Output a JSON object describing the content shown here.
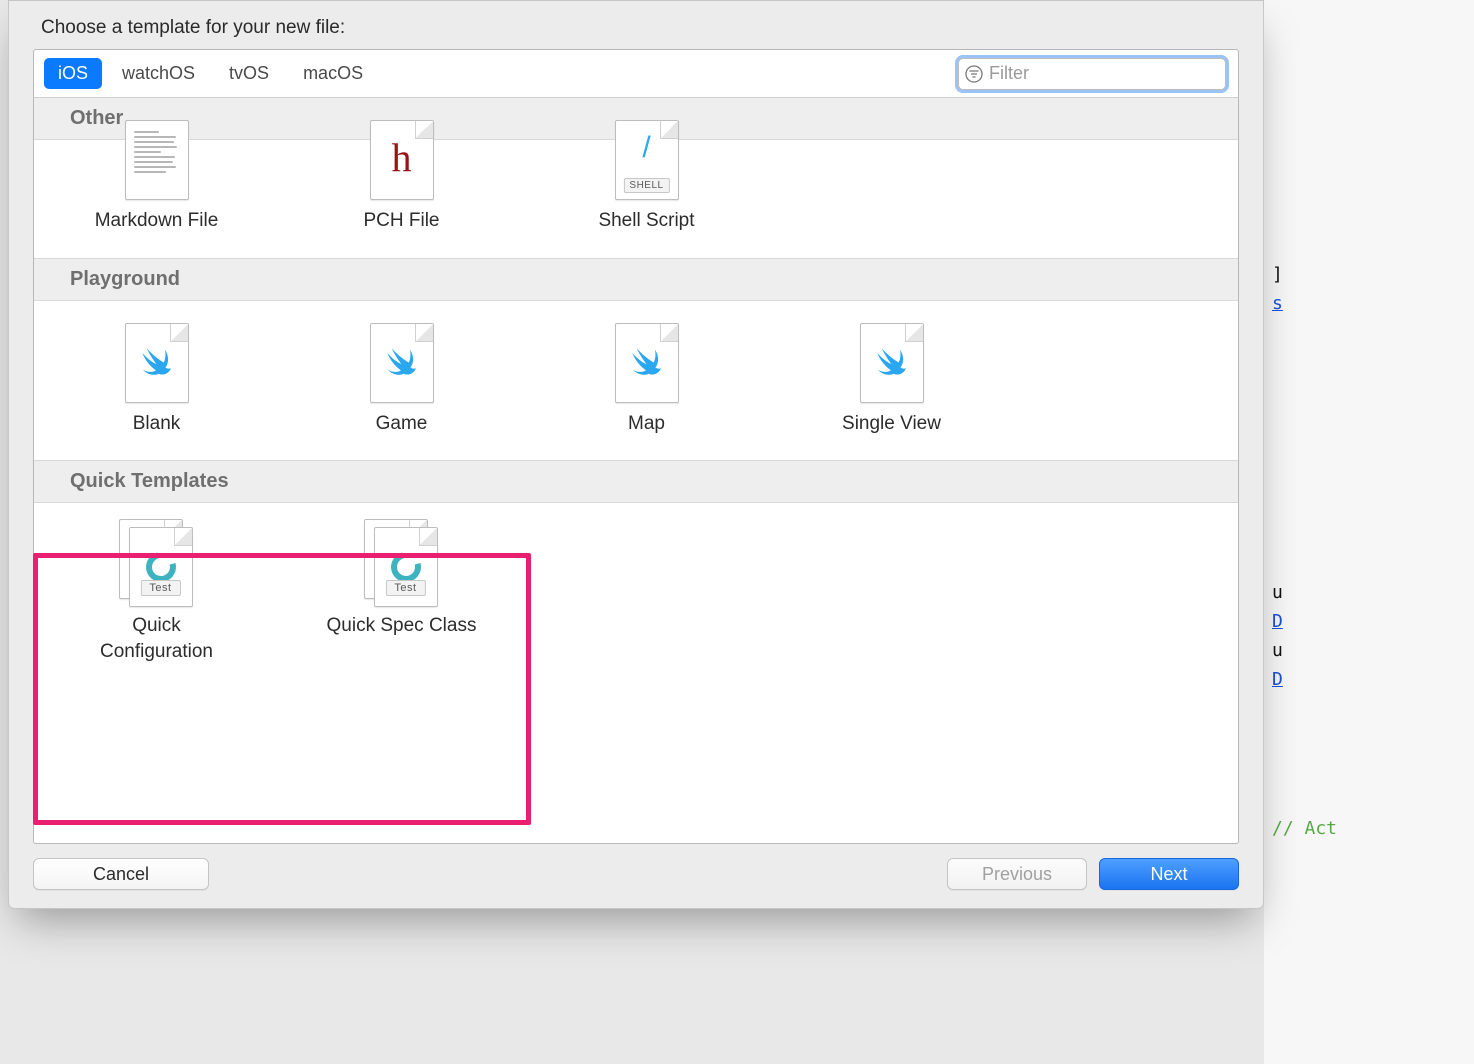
{
  "title": "Choose a template for your new file:",
  "platforms": [
    "iOS",
    "watchOS",
    "tvOS",
    "macOS"
  ],
  "selected_platform_index": 0,
  "filter": {
    "placeholder": "Filter",
    "value": ""
  },
  "sections": [
    {
      "name": "Other",
      "items": [
        {
          "label": "Markdown File",
          "icon": "markdown"
        },
        {
          "label": "PCH File",
          "icon": "pch"
        },
        {
          "label": "Shell Script",
          "icon": "shell"
        }
      ]
    },
    {
      "name": "Playground",
      "items": [
        {
          "label": "Blank",
          "icon": "swift"
        },
        {
          "label": "Game",
          "icon": "swift"
        },
        {
          "label": "Map",
          "icon": "swift"
        },
        {
          "label": "Single View",
          "icon": "swift"
        }
      ]
    },
    {
      "name": "Quick Templates",
      "items": [
        {
          "label": "Quick\nConfiguration",
          "icon": "quick"
        },
        {
          "label": "Quick Spec Class",
          "icon": "quick"
        }
      ]
    }
  ],
  "buttons": {
    "cancel": "Cancel",
    "previous": "Previous",
    "next": "Next"
  },
  "annotation": {
    "section": "Quick Templates"
  }
}
